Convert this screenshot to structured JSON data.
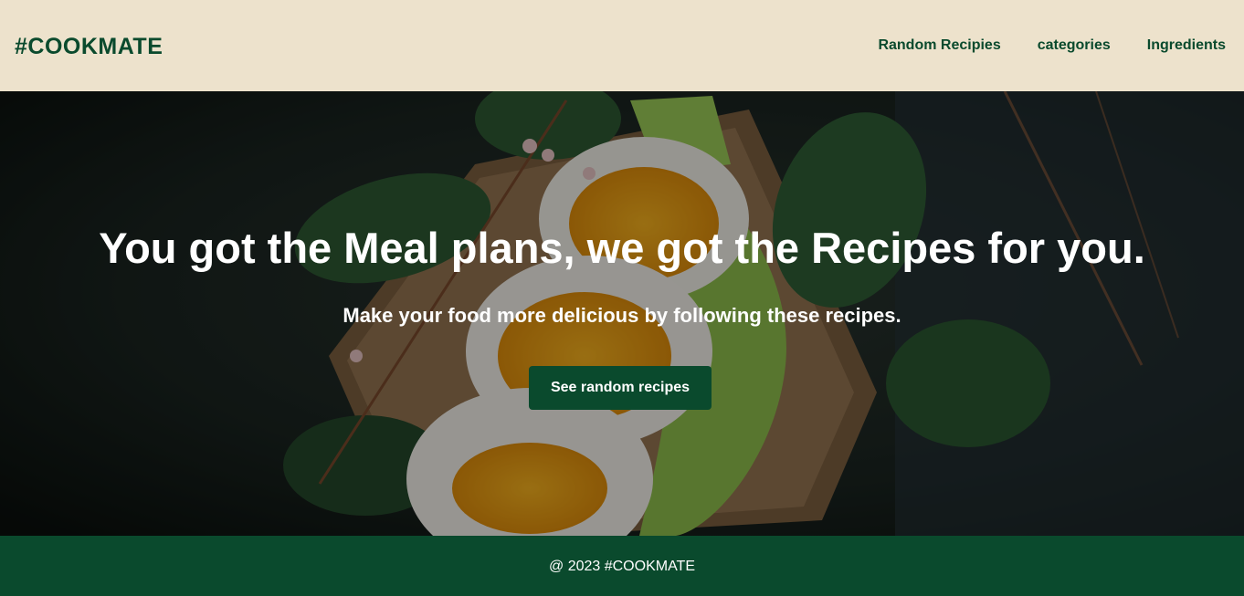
{
  "header": {
    "logo": "#COOKMATE",
    "nav": [
      {
        "label": "Random Recipies"
      },
      {
        "label": "categories"
      },
      {
        "label": "Ingredients"
      }
    ]
  },
  "hero": {
    "background_image": "egg-avocado-toast-photo",
    "title": "You got the Meal plans, we got the Recipes for you.",
    "subtitle": "Make your food more delicious by following these recipes.",
    "cta_label": "See random recipes"
  },
  "footer": {
    "copyright": "@ 2023 #COOKMATE"
  },
  "colors": {
    "header_bg": "#ede2cc",
    "brand_green": "#0a4a2d",
    "text_light": "#ffffff"
  }
}
